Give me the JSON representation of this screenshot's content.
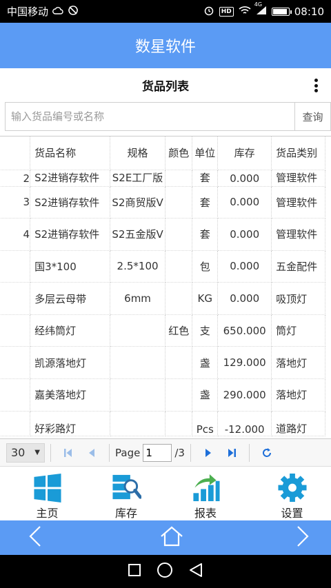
{
  "status_bar": {
    "carrier": "中国移动",
    "time": "08:10",
    "hd_label": "HD",
    "network_label": "4G",
    "battery_level": 0.85
  },
  "app": {
    "title": "数星软件"
  },
  "page": {
    "title": "货品列表"
  },
  "search": {
    "placeholder": "输入货品编号或名称",
    "button_label": "查询"
  },
  "table": {
    "columns": [
      "货品名称",
      "规格",
      "颜色",
      "单位",
      "库存",
      "货品类别"
    ],
    "rows": [
      {
        "id_fragment": "2",
        "name": "S2进销存软件",
        "spec": "S2E工厂版",
        "color": "",
        "unit": "套",
        "stock": "0.000",
        "category": "管理软件"
      },
      {
        "id_fragment": "3",
        "name": "S2进销存软件",
        "spec": "S2商贸版V",
        "color": "",
        "unit": "套",
        "stock": "0.000",
        "category": "管理软件"
      },
      {
        "id_fragment": "4",
        "name": "S2进销存软件",
        "spec": "S2五金版V",
        "color": "",
        "unit": "套",
        "stock": "0.000",
        "category": "管理软件"
      },
      {
        "id_fragment": "",
        "name": "国3*100",
        "spec": "2.5*100",
        "color": "",
        "unit": "包",
        "stock": "0.000",
        "category": "五金配件"
      },
      {
        "id_fragment": "",
        "name": "多层云母带",
        "spec": "6mm",
        "color": "",
        "unit": "KG",
        "stock": "0.000",
        "category": "吸顶灯"
      },
      {
        "id_fragment": "",
        "name": "经纬筒灯",
        "spec": "",
        "color": "红色",
        "unit": "支",
        "stock": "650.000",
        "category": "筒灯"
      },
      {
        "id_fragment": "",
        "name": "凯源落地灯",
        "spec": "",
        "color": "",
        "unit": "盏",
        "stock": "129.000",
        "category": "落地灯"
      },
      {
        "id_fragment": "",
        "name": "嘉美落地灯",
        "spec": "",
        "color": "",
        "unit": "盏",
        "stock": "290.000",
        "category": "落地灯"
      },
      {
        "id_fragment": "",
        "name": "好彩路灯",
        "spec": "",
        "color": "",
        "unit": "Pcs",
        "stock": "-12.000",
        "category": "道路灯"
      }
    ]
  },
  "pager": {
    "page_size": "30",
    "page_label": "Page",
    "current_page": "1",
    "total_pages_label": "/3"
  },
  "bottom_nav": {
    "items": [
      {
        "label": "主页",
        "icon": "windows-tiles-icon"
      },
      {
        "label": "库存",
        "icon": "server-search-icon"
      },
      {
        "label": "报表",
        "icon": "bar-chart-arrow-icon"
      },
      {
        "label": "设置",
        "icon": "gear-icon"
      }
    ]
  },
  "colors": {
    "primary": "#5b9bf4",
    "icon_blue": "#1a9bd7",
    "icon_green": "#4caf50"
  }
}
